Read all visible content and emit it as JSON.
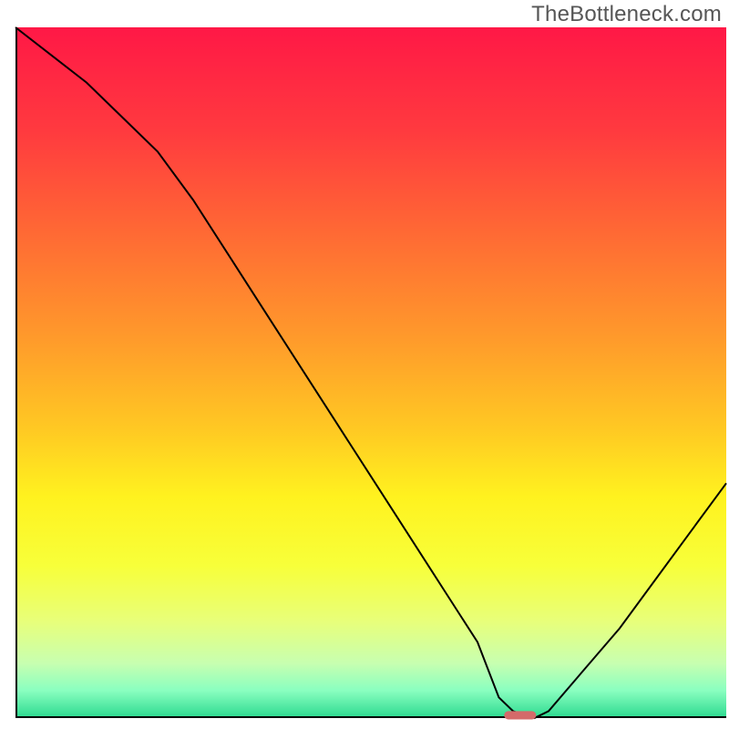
{
  "watermark": "TheBottleneck.com",
  "chart_data": {
    "type": "line",
    "title": "",
    "xlabel": "",
    "ylabel": "",
    "xlim": [
      0,
      100
    ],
    "ylim": [
      0,
      100
    ],
    "x": [
      0,
      5,
      10,
      15,
      20,
      25,
      30,
      35,
      40,
      45,
      50,
      55,
      60,
      65,
      68,
      70,
      73,
      75,
      80,
      85,
      90,
      95,
      100
    ],
    "values": [
      100,
      96,
      92,
      87,
      82,
      75,
      67,
      59,
      51,
      43,
      35,
      27,
      19,
      11,
      3,
      1,
      0,
      1,
      7,
      13,
      20,
      27,
      34
    ],
    "marker": {
      "x": 71,
      "y": 0.4,
      "width": 4.5,
      "height": 1.2,
      "color": "#d46a6a"
    },
    "gradient_stops": [
      {
        "offset": 0.0,
        "color": "#ff1846"
      },
      {
        "offset": 0.15,
        "color": "#ff3a3f"
      },
      {
        "offset": 0.3,
        "color": "#ff6a34"
      },
      {
        "offset": 0.45,
        "color": "#ff9a2b"
      },
      {
        "offset": 0.58,
        "color": "#ffc823"
      },
      {
        "offset": 0.68,
        "color": "#fff21f"
      },
      {
        "offset": 0.78,
        "color": "#f7ff3a"
      },
      {
        "offset": 0.86,
        "color": "#e8ff7a"
      },
      {
        "offset": 0.92,
        "color": "#c8ffb0"
      },
      {
        "offset": 0.96,
        "color": "#8affc0"
      },
      {
        "offset": 1.0,
        "color": "#2bd98f"
      }
    ],
    "frame_color": "#000000",
    "line_color": "#000000",
    "line_width": 2
  }
}
